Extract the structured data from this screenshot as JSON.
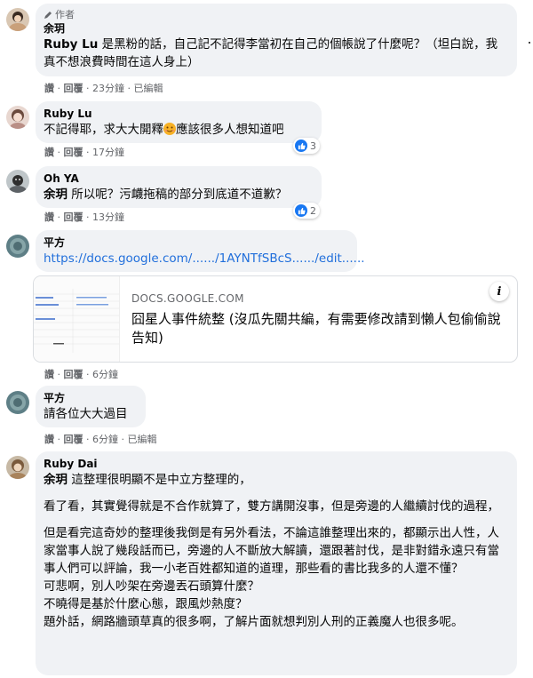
{
  "comments": [
    {
      "author_tag": "作者",
      "name": "余玥",
      "mention": "Ruby Lu",
      "text": " 是黑粉的話，自己記不記得李當初在自己的個帳說了什麼呢？（坦白說，我真不想浪費時間在這人身上）",
      "actions": {
        "like": "讚",
        "reply": "回覆",
        "time": "23分鐘",
        "edited": "已編輯"
      }
    },
    {
      "name": "Ruby Lu",
      "text_before": "不記得耶，求大大開釋",
      "text_after": "應該很多人想知道吧",
      "reactions": "3",
      "actions": {
        "like": "讚",
        "reply": "回覆",
        "time": "17分鐘"
      }
    },
    {
      "name": "Oh YA",
      "mention": "余玥",
      "text": " 所以呢？污衊拖稿的部分到底道不道歉？",
      "reactions": "2",
      "actions": {
        "like": "讚",
        "reply": "回覆",
        "time": "13分鐘"
      }
    },
    {
      "name": "平方",
      "link": "https://docs.google.com/....../1AYNTfSBcS....../edit......",
      "card": {
        "domain": "DOCS.GOOGLE.COM",
        "title": "囧星人事件統整 (沒瓜先關共編，有需要修改請到懶人包偷偷說告知)",
        "info": "i"
      },
      "actions": {
        "like": "讚",
        "reply": "回覆",
        "time": "6分鐘"
      }
    },
    {
      "name": "平方",
      "text": "請各位大大過目",
      "actions": {
        "like": "讚",
        "reply": "回覆",
        "time": "6分鐘",
        "edited": "已編輯"
      }
    },
    {
      "name": "Ruby Dai",
      "mention": "余玥",
      "p1": " 這整理很明顯不是中立方整理的，",
      "p2": "看了看，其實覺得就是不合作就算了，雙方講開沒事，但是旁邊的人繼續討伐的過程，",
      "p3": "但是看完這奇妙的整理後我倒是有另外看法，不論這誰整理出來的，都顯示出人性，人家當事人說了幾段話而已，旁邊的人不斷放大解讀，還跟著討伐，是非對錯永遠只有當事人們可以評論，我一小老百姓都知道的道理，那些看的書比我多的人還不懂？",
      "p4": "可悲啊，別人吵架在旁邊丟石頭算什麼？",
      "p5": "不曉得是基於什麼心態，跟風炒熱度？",
      "p6": "題外話，網路牆頭草真的很多啊，了解片面就想判別人刑的正義魔人也很多呢。"
    }
  ],
  "meta_separator": " · ",
  "colors": {
    "link": "#216fdb",
    "bubble": "#f0f2f5",
    "like": "#1877f2",
    "meta": "#65676b"
  }
}
